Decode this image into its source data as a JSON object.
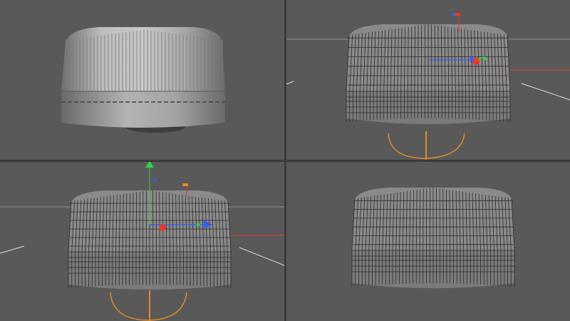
{
  "app": {
    "colors": {
      "viewport_bg": "#595959",
      "model_light": "#bcbcbc",
      "model_mid": "#8f8f8f",
      "model_dark": "#5c5c5c",
      "wire": "#2a2a2a",
      "axis_x": "#e23b2b",
      "axis_y": "#2bd34a",
      "axis_z": "#2f5bff",
      "rotate_ring": "#e08a2a",
      "grid_line": "#d0d0d0"
    }
  },
  "viewports": [
    {
      "id": "top-left",
      "mode": "shaded",
      "wireframe": false,
      "gizmo": false
    },
    {
      "id": "top-right",
      "mode": "shaded-wire",
      "wireframe": true,
      "gizmo": true
    },
    {
      "id": "bottom-left",
      "mode": "shaded-wire",
      "wireframe": true,
      "gizmo": true
    },
    {
      "id": "bottom-right",
      "mode": "shaded-wire",
      "wireframe": true,
      "gizmo": false
    }
  ]
}
